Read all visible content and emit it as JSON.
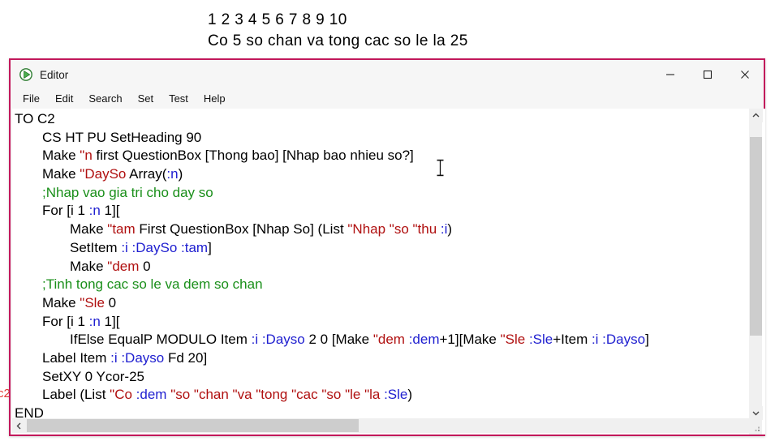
{
  "background": {
    "numbers_line": "1 2 3 4 5 6 7 8 9 10",
    "summary_line": "Co 5 so chan va tong cac so le la 25",
    "partial_label": "c2"
  },
  "window": {
    "title": "Editor",
    "icon": "play-triangle-icon",
    "border_color": "#c2185b",
    "controls": {
      "minimize": "─",
      "maximize": "□",
      "close": "✕"
    }
  },
  "menu": {
    "items": [
      {
        "label": "File"
      },
      {
        "label": "Edit"
      },
      {
        "label": "Search"
      },
      {
        "label": "Set"
      },
      {
        "label": "Test"
      },
      {
        "label": "Help"
      }
    ]
  },
  "editor": {
    "lines": [
      {
        "indent": 0,
        "tokens": [
          {
            "t": "TO C2",
            "c": "black"
          }
        ]
      },
      {
        "indent": 1,
        "tokens": [
          {
            "t": "CS HT PU SetHeading 90",
            "c": "black"
          }
        ]
      },
      {
        "indent": 1,
        "tokens": [
          {
            "t": "Make ",
            "c": "black"
          },
          {
            "t": "\"n",
            "c": "red"
          },
          {
            "t": " first QuestionBox [Thong bao] [Nhap bao nhieu so?]",
            "c": "black"
          }
        ]
      },
      {
        "indent": 1,
        "tokens": [
          {
            "t": "Make ",
            "c": "black"
          },
          {
            "t": "\"DaySo",
            "c": "red"
          },
          {
            "t": " Array(",
            "c": "black"
          },
          {
            "t": ":n",
            "c": "blue"
          },
          {
            "t": ")",
            "c": "black"
          }
        ]
      },
      {
        "indent": 1,
        "tokens": [
          {
            "t": ";Nhap vao gia tri cho day so",
            "c": "green"
          }
        ]
      },
      {
        "indent": 1,
        "tokens": [
          {
            "t": "For [i 1 ",
            "c": "black"
          },
          {
            "t": ":n",
            "c": "blue"
          },
          {
            "t": " 1][",
            "c": "black"
          }
        ]
      },
      {
        "indent": 2,
        "tokens": [
          {
            "t": "Make ",
            "c": "black"
          },
          {
            "t": "\"tam",
            "c": "red"
          },
          {
            "t": " First QuestionBox [Nhap So] (List ",
            "c": "black"
          },
          {
            "t": "\"Nhap ",
            "c": "red"
          },
          {
            "t": "\"so ",
            "c": "red"
          },
          {
            "t": "\"thu ",
            "c": "red"
          },
          {
            "t": ":i",
            "c": "blue"
          },
          {
            "t": ")",
            "c": "black"
          }
        ]
      },
      {
        "indent": 2,
        "tokens": [
          {
            "t": "SetItem ",
            "c": "black"
          },
          {
            "t": ":i :DaySo :tam",
            "c": "blue"
          },
          {
            "t": "]",
            "c": "black"
          }
        ]
      },
      {
        "indent": 2,
        "tokens": [
          {
            "t": "Make ",
            "c": "black"
          },
          {
            "t": "\"dem",
            "c": "red"
          },
          {
            "t": " 0",
            "c": "black"
          }
        ]
      },
      {
        "indent": 1,
        "tokens": [
          {
            "t": ";Tinh tong cac so le va dem so chan",
            "c": "green"
          }
        ]
      },
      {
        "indent": 1,
        "tokens": [
          {
            "t": "Make ",
            "c": "black"
          },
          {
            "t": "\"Sle",
            "c": "red"
          },
          {
            "t": " 0",
            "c": "black"
          }
        ]
      },
      {
        "indent": 1,
        "tokens": [
          {
            "t": "For [i 1 ",
            "c": "black"
          },
          {
            "t": ":n",
            "c": "blue"
          },
          {
            "t": " 1][",
            "c": "black"
          }
        ]
      },
      {
        "indent": 2,
        "tokens": [
          {
            "t": "IfElse EqualP MODULO Item ",
            "c": "black"
          },
          {
            "t": ":i :Dayso",
            "c": "blue"
          },
          {
            "t": " 2 0 [Make ",
            "c": "black"
          },
          {
            "t": "\"dem ",
            "c": "red"
          },
          {
            "t": ":dem",
            "c": "blue"
          },
          {
            "t": "+1][Make ",
            "c": "black"
          },
          {
            "t": "\"Sle ",
            "c": "red"
          },
          {
            "t": ":Sle",
            "c": "blue"
          },
          {
            "t": "+Item ",
            "c": "black"
          },
          {
            "t": ":i :Dayso",
            "c": "blue"
          },
          {
            "t": "]",
            "c": "black"
          }
        ]
      },
      {
        "indent": 1,
        "tokens": [
          {
            "t": "Label Item ",
            "c": "black"
          },
          {
            "t": ":i :Dayso",
            "c": "blue"
          },
          {
            "t": " Fd 20]",
            "c": "black"
          }
        ]
      },
      {
        "indent": 1,
        "tokens": [
          {
            "t": "SetXY 0 Ycor-25",
            "c": "black"
          }
        ]
      },
      {
        "indent": 1,
        "tokens": [
          {
            "t": "Label (List ",
            "c": "black"
          },
          {
            "t": "\"Co ",
            "c": "red"
          },
          {
            "t": ":dem ",
            "c": "blue"
          },
          {
            "t": "\"so ",
            "c": "red"
          },
          {
            "t": "\"chan ",
            "c": "red"
          },
          {
            "t": "\"va ",
            "c": "red"
          },
          {
            "t": "\"tong ",
            "c": "red"
          },
          {
            "t": "\"cac ",
            "c": "red"
          },
          {
            "t": "\"so ",
            "c": "red"
          },
          {
            "t": "\"le ",
            "c": "red"
          },
          {
            "t": "\"la ",
            "c": "red"
          },
          {
            "t": ":Sle",
            "c": "blue"
          },
          {
            "t": ")",
            "c": "black"
          }
        ]
      },
      {
        "indent": 0,
        "tokens": [
          {
            "t": "END",
            "c": "black"
          }
        ]
      }
    ],
    "syntax_colors": {
      "black": "#000000",
      "red": "#b01010",
      "blue": "#2020d0",
      "green": "#1a8f1a"
    }
  },
  "scrollbars": {
    "vertical": {
      "up_arrow": "▲",
      "down_arrow": "▼"
    },
    "horizontal": {
      "left_arrow": "◀"
    }
  }
}
